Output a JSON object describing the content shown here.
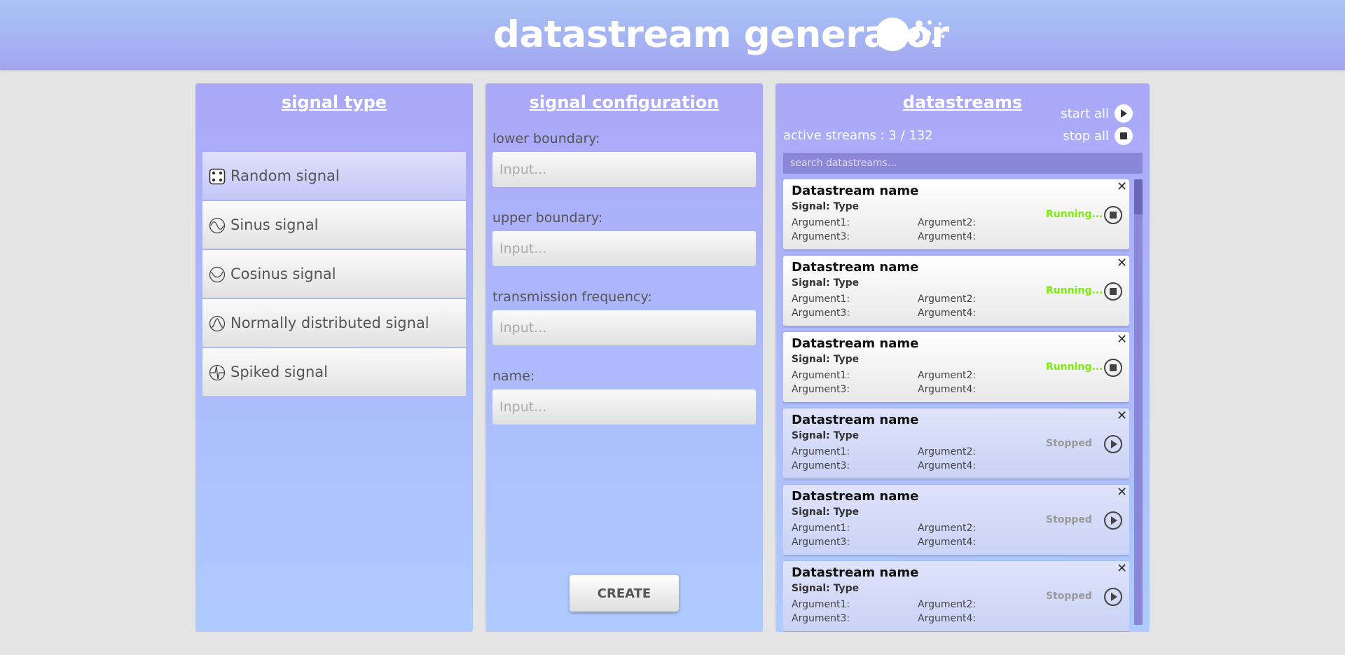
{
  "header": {
    "title": "datastream generator",
    "logo_icon": "bubbles-logo-icon"
  },
  "signal_type": {
    "title": "signal type",
    "items": [
      {
        "label": "Random signal",
        "icon": "dice-icon",
        "active": true
      },
      {
        "label": "Sinus signal",
        "icon": "sine-wave-icon",
        "active": false
      },
      {
        "label": "Cosinus signal",
        "icon": "cosine-wave-icon",
        "active": false
      },
      {
        "label": "Normally distributed signal",
        "icon": "bell-curve-icon",
        "active": false
      },
      {
        "label": "Spiked signal",
        "icon": "spike-icon",
        "active": false
      }
    ]
  },
  "signal_configuration": {
    "title": "signal configuration",
    "fields": [
      {
        "label": "lower boundary:",
        "placeholder": "Input..."
      },
      {
        "label": "upper boundary:",
        "placeholder": "Input..."
      },
      {
        "label": "transmission frequency:",
        "placeholder": "Input..."
      },
      {
        "label": "name:",
        "placeholder": "Input..."
      }
    ],
    "create_label": "CREATE"
  },
  "datastreams": {
    "title": "datastreams",
    "start_all_label": "start all",
    "stop_all_label": "stop all",
    "active_streams": "active streams : 3 / 132",
    "search_placeholder": "search datastreams...",
    "streams": [
      {
        "name": "Datastream name",
        "type": "Signal: Type",
        "arg1": "Argument1:",
        "arg2": "Argument2:",
        "arg3": "Argument3:",
        "arg4": "Argument4:",
        "status": "Running...",
        "state": "running"
      },
      {
        "name": "Datastream name",
        "type": "Signal: Type",
        "arg1": "Argument1:",
        "arg2": "Argument2:",
        "arg3": "Argument3:",
        "arg4": "Argument4:",
        "status": "Running...",
        "state": "running"
      },
      {
        "name": "Datastream name",
        "type": "Signal: Type",
        "arg1": "Argument1:",
        "arg2": "Argument2:",
        "arg3": "Argument3:",
        "arg4": "Argument4:",
        "status": "Running...",
        "state": "running"
      },
      {
        "name": "Datastream name",
        "type": "Signal: Type",
        "arg1": "Argument1:",
        "arg2": "Argument2:",
        "arg3": "Argument3:",
        "arg4": "Argument4:",
        "status": "Stopped",
        "state": "stopped"
      },
      {
        "name": "Datastream name",
        "type": "Signal: Type",
        "arg1": "Argument1:",
        "arg2": "Argument2:",
        "arg3": "Argument3:",
        "arg4": "Argument4:",
        "status": "Stopped",
        "state": "stopped"
      },
      {
        "name": "Datastream name",
        "type": "Signal: Type",
        "arg1": "Argument1:",
        "arg2": "Argument2:",
        "arg3": "Argument3:",
        "arg4": "Argument4:",
        "status": "Stopped",
        "state": "stopped"
      }
    ]
  },
  "colors": {
    "running": "#7ded0a",
    "stopped": "#999999",
    "accent": "#a3a6f2"
  }
}
